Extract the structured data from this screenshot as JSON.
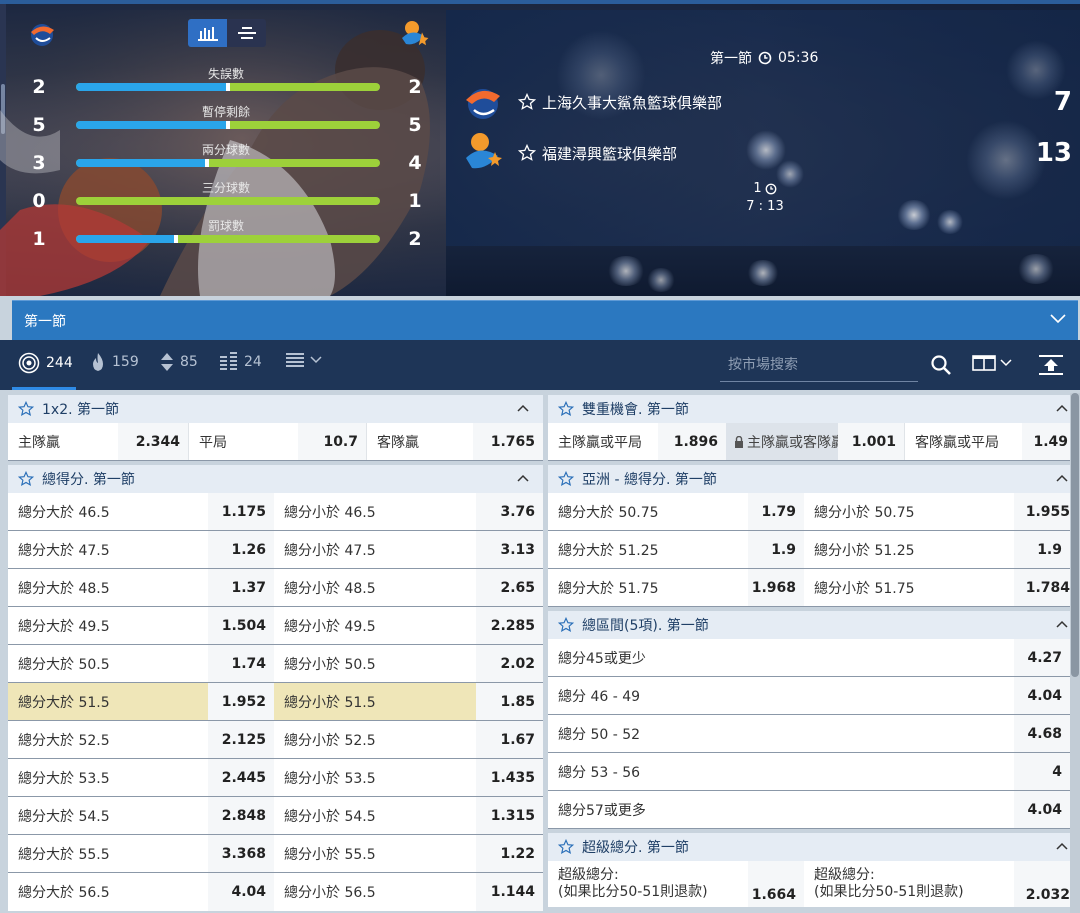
{
  "stats": [
    {
      "label": "失誤數",
      "home": "2",
      "away": "2",
      "home_share": 0.5
    },
    {
      "label": "暫停剩餘",
      "home": "5",
      "away": "5",
      "home_share": 0.5
    },
    {
      "label": "兩分球數",
      "home": "3",
      "away": "4",
      "home_share": 0.43
    },
    {
      "label": "三分球數",
      "home": "0",
      "away": "1",
      "home_share": 0.0
    },
    {
      "label": "罰球數",
      "home": "1",
      "away": "2",
      "home_share": 0.33
    }
  ],
  "scoreboard": {
    "period": "第一節",
    "clock": "05:36",
    "home": {
      "name": "上海久事大鯊魚籃球俱樂部",
      "score": "7"
    },
    "away": {
      "name": "福建潯興籃球俱樂部",
      "score": "13"
    },
    "possession": "1",
    "period_score": "7 : 13"
  },
  "period_select": "第一節",
  "toolbar": {
    "all_count": "244",
    "hot_count": "159",
    "updown_count": "85",
    "list_count": "24",
    "search_placeholder": "按市場搜索"
  },
  "left": {
    "m1": {
      "title": "1x2. 第一節",
      "home_lbl": "主隊贏",
      "home_odd": "2.344",
      "draw_lbl": "平局",
      "draw_odd": "10.7",
      "away_lbl": "客隊贏",
      "away_odd": "1.765"
    },
    "m2": {
      "title": "總得分. 第一節",
      "rows": [
        {
          "over": "總分大於 46.5",
          "over_odd": "1.175",
          "under": "總分小於 46.5",
          "under_odd": "3.76"
        },
        {
          "over": "總分大於 47.5",
          "over_odd": "1.26",
          "under": "總分小於 47.5",
          "under_odd": "3.13"
        },
        {
          "over": "總分大於 48.5",
          "over_odd": "1.37",
          "under": "總分小於 48.5",
          "under_odd": "2.65"
        },
        {
          "over": "總分大於 49.5",
          "over_odd": "1.504",
          "under": "總分小於 49.5",
          "under_odd": "2.285"
        },
        {
          "over": "總分大於 50.5",
          "over_odd": "1.74",
          "under": "總分小於 50.5",
          "under_odd": "2.02"
        },
        {
          "over": "總分大於 51.5",
          "over_odd": "1.952",
          "under": "總分小於 51.5",
          "under_odd": "1.85"
        },
        {
          "over": "總分大於 52.5",
          "over_odd": "2.125",
          "under": "總分小於 52.5",
          "under_odd": "1.67"
        },
        {
          "over": "總分大於 53.5",
          "over_odd": "2.445",
          "under": "總分小於 53.5",
          "under_odd": "1.435"
        },
        {
          "over": "總分大於 54.5",
          "over_odd": "2.848",
          "under": "總分小於 54.5",
          "under_odd": "1.315"
        },
        {
          "over": "總分大於 55.5",
          "over_odd": "3.368",
          "under": "總分小於 55.5",
          "under_odd": "1.22"
        },
        {
          "over": "總分大於 56.5",
          "over_odd": "4.04",
          "under": "總分小於 56.5",
          "under_odd": "1.144"
        }
      ]
    }
  },
  "right": {
    "m1": {
      "title": "雙重機會. 第一節",
      "a_lbl": "主隊贏或平局",
      "a_odd": "1.896",
      "b_lbl": "主隊贏或客隊贏",
      "b_odd": "1.001",
      "c_lbl": "客隊贏或平局",
      "c_odd": "1.49"
    },
    "m2": {
      "title": "亞洲 - 總得分. 第一節",
      "rows": [
        {
          "over": "總分大於 50.75",
          "over_odd": "1.79",
          "under": "總分小於 50.75",
          "under_odd": "1.955"
        },
        {
          "over": "總分大於 51.25",
          "over_odd": "1.9",
          "under": "總分小於 51.25",
          "under_odd": "1.9"
        },
        {
          "over": "總分大於 51.75",
          "over_odd": "1.968",
          "under": "總分小於 51.75",
          "under_odd": "1.784"
        }
      ]
    },
    "m3": {
      "title": "總區間(5項). 第一節",
      "rows": [
        {
          "label": "總分45或更少",
          "odd": "4.27"
        },
        {
          "label": "總分 46 - 49",
          "odd": "4.04"
        },
        {
          "label": "總分 50 - 52",
          "odd": "4.68"
        },
        {
          "label": "總分 53 - 56",
          "odd": "4"
        },
        {
          "label": "總分57或更多",
          "odd": "4.04"
        }
      ]
    },
    "m4": {
      "title": "超級總分. 第一節",
      "a_lbl1": "超級總分:",
      "a_lbl2": "(如果比分50-51則退款)",
      "a_odd": "1.664",
      "b_lbl1": "超級總分:",
      "b_lbl2": "(如果比分50-51則退款)",
      "b_odd": "2.032"
    }
  },
  "colors": {
    "accent": "#2b78c0",
    "highlight": "#efe6b8",
    "bar_home": "#2aa5ea",
    "bar_away": "#9dd13a"
  }
}
